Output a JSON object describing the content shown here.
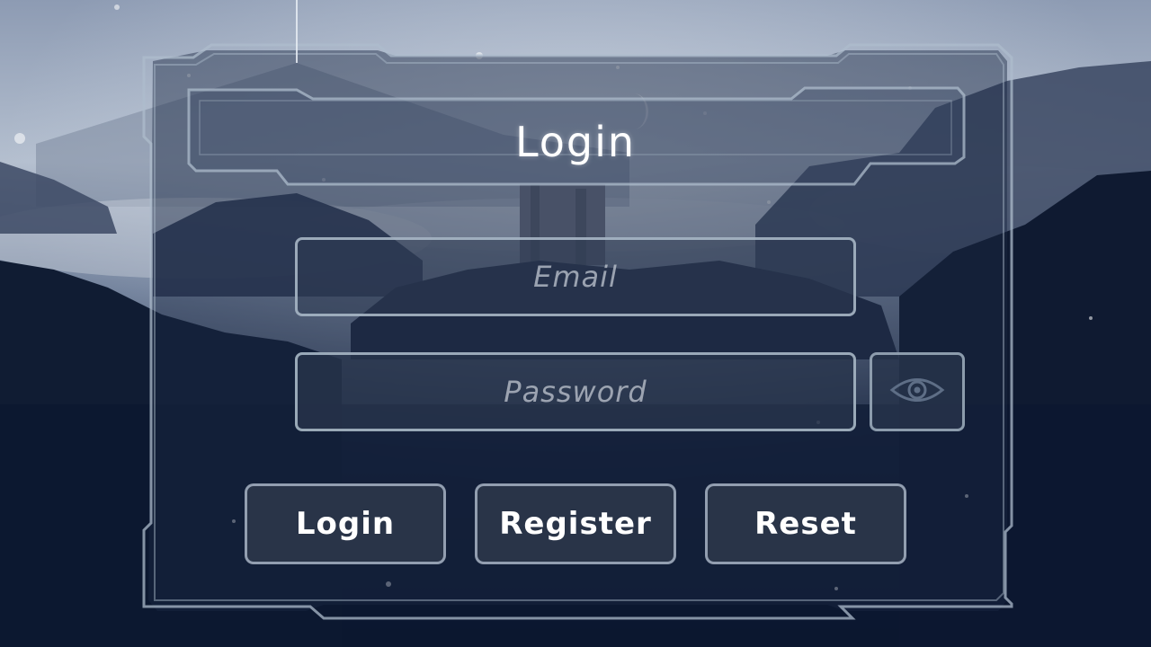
{
  "form": {
    "title": "Login",
    "email_placeholder": "Email",
    "password_placeholder": "Password"
  },
  "buttons": {
    "login": "Login",
    "register": "Register",
    "reset": "Reset"
  },
  "icons": {
    "password_toggle": "eye-icon"
  },
  "colors": {
    "frame_line": "#aebccc",
    "panel_fill": "#1c2a44",
    "button_fill": "#2c364a",
    "text_primary": "#ffffff",
    "placeholder": "#c3c8d2"
  }
}
